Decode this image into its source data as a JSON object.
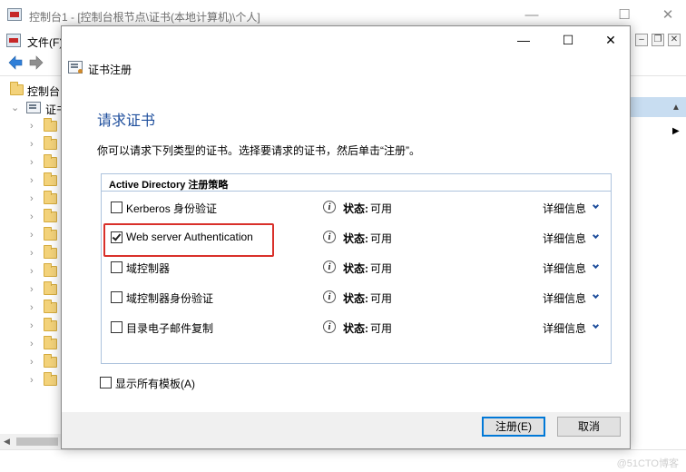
{
  "mmc": {
    "title": "控制台1 - [控制台根节点\\证书(本地计算机)\\个人]",
    "window_controls": {
      "minimize": "—",
      "maximize": "☐",
      "close": "✕"
    },
    "menu": {
      "file_label": "文件(F)"
    },
    "mdi_controls": {
      "minimize": "–",
      "restore": "❐",
      "close": "✕"
    },
    "tree": {
      "root_label": "控制台",
      "cert_label": "证书"
    },
    "watermark": "@51CTO博客"
  },
  "dialog": {
    "window_controls": {
      "minimize": "—",
      "maximize": "☐",
      "close": "✕"
    },
    "nav_title": "证书注册",
    "heading": "请求证书",
    "instruction": "你可以请求下列类型的证书。选择要请求的证书，然后单击“注册”。",
    "policy": {
      "title": "Active Directory 注册策略",
      "templates": [
        {
          "name": "Kerberos 身份验证",
          "checked": false,
          "status_label": "状态:",
          "status_value": "可用",
          "details": "详细信息"
        },
        {
          "name": "Web server Authentication",
          "checked": true,
          "status_label": "状态:",
          "status_value": "可用",
          "details": "详细信息"
        },
        {
          "name": "域控制器",
          "checked": false,
          "status_label": "状态:",
          "status_value": "可用",
          "details": "详细信息"
        },
        {
          "name": "域控制器身份验证",
          "checked": false,
          "status_label": "状态:",
          "status_value": "可用",
          "details": "详细信息"
        },
        {
          "name": "目录电子邮件复制",
          "checked": false,
          "status_label": "状态:",
          "status_value": "可用",
          "details": "详细信息"
        }
      ]
    },
    "show_all_label": "显示所有模板(A)",
    "show_all_checked": false,
    "buttons": {
      "enroll": "注册(E)",
      "cancel": "取消"
    }
  },
  "colors": {
    "heading": "#1e4e9c",
    "highlight": "#d9302a",
    "action_header": "#c8ddf1",
    "folder": "#f3d27a"
  },
  "icons": [
    "mmc-app-icon",
    "back-arrow-icon",
    "forward-arrow-icon",
    "folder-icon",
    "certificate-icon",
    "info-icon",
    "chevron-down-icon"
  ]
}
